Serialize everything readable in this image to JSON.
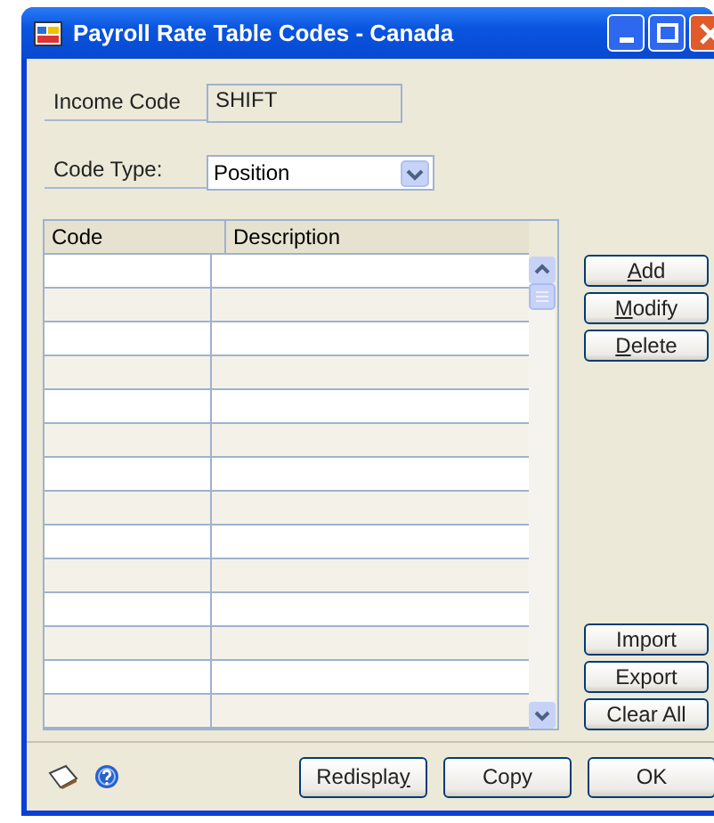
{
  "window": {
    "title": "Payroll Rate Table Codes - Canada"
  },
  "income_code": {
    "label": "Income Code",
    "value": "SHIFT"
  },
  "code_type": {
    "label": "Code Type:",
    "value": "Position"
  },
  "table": {
    "columns": [
      "Code",
      "Description"
    ]
  },
  "side_buttons_top": [
    {
      "label_parts": [
        {
          "text": "A",
          "underlined": true
        },
        {
          "text": "dd",
          "underlined": false
        }
      ]
    },
    {
      "label_parts": [
        {
          "text": "M",
          "underlined": true
        },
        {
          "text": "odify",
          "underlined": false
        }
      ]
    },
    {
      "label_parts": [
        {
          "text": "D",
          "underlined": true
        },
        {
          "text": "elete",
          "underlined": false
        }
      ]
    }
  ],
  "side_buttons_bottom": [
    {
      "label": "Import"
    },
    {
      "label": "Export"
    },
    {
      "label": "Clear All"
    }
  ],
  "bottom_buttons": [
    {
      "label_parts": [
        {
          "text": "Redispla",
          "underlined": false
        },
        {
          "text": "y",
          "underlined": true
        }
      ]
    },
    {
      "label": "Copy"
    },
    {
      "label": "OK"
    }
  ]
}
